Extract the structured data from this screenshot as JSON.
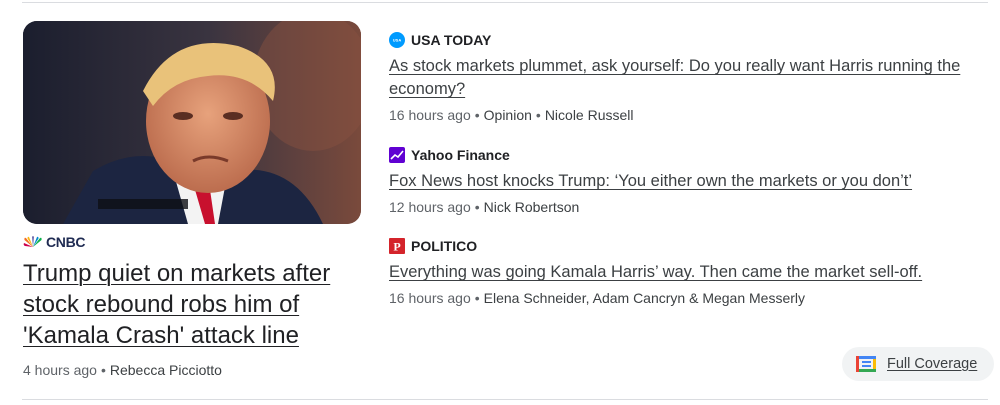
{
  "lead": {
    "source": "CNBC",
    "title": "Trump quiet on markets after stock rebound robs him of 'Kamala Crash' attack line",
    "time": "4 hours ago",
    "author": "Rebecca Picciotto"
  },
  "stories": [
    {
      "source": "USA TODAY",
      "title": "As stock markets plummet, ask yourself: Do you really want Harris running the economy?",
      "time": "16 hours ago",
      "section": "Opinion",
      "author": "Nicole Russell",
      "icon": "usa-today-icon",
      "icon_color": "#009bff"
    },
    {
      "source": "Yahoo Finance",
      "title": "Fox News host knocks Trump: ‘You either own the markets or you don’t’",
      "time": "12 hours ago",
      "author": "Nick Robertson",
      "icon": "yahoo-finance-icon",
      "icon_color": "#6001d2"
    },
    {
      "source": "POLITICO",
      "title": "Everything was going Kamala Harris’ way. Then came the market sell-off.",
      "time": "16 hours ago",
      "author": "Elena Schneider, Adam Cancryn & Megan Messerly",
      "icon": "politico-icon",
      "icon_color": "#d4242b"
    }
  ],
  "full_coverage": {
    "label": "Full Coverage",
    "icon": "full-coverage-icon"
  },
  "separator": "•"
}
